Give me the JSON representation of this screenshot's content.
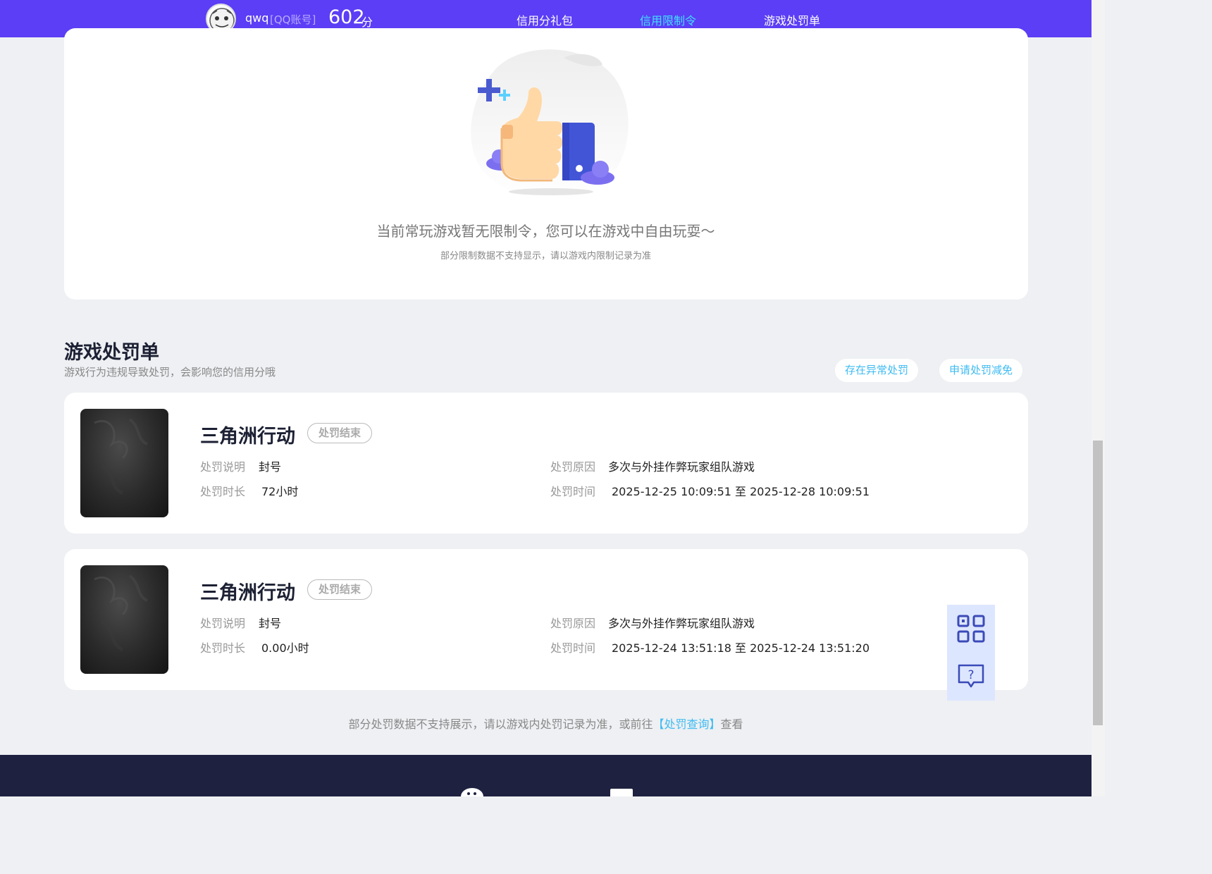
{
  "header": {
    "username": "qwq",
    "account_type": "[QQ账号]",
    "score": "602",
    "score_unit": "分",
    "tabs": [
      "信用分礼包",
      "信用限制令",
      "游戏处罚单"
    ],
    "active_tab": "信用限制令"
  },
  "restriction": {
    "message": "当前常玩游戏暂无限制令，您可以在游戏中自由玩耍～",
    "sub_message": "部分限制数据不支持显示，请以游戏内限制记录为准"
  },
  "penalty_section": {
    "title": "游戏处罚单",
    "description": "游戏行为违规导致处罚，会影响您的信用分哦",
    "buttons": [
      "存在异常处罚",
      "申请处罚减免"
    ]
  },
  "penalty_labels": {
    "desc": "处罚说明",
    "duration": "处罚时长",
    "reason": "处罚原因",
    "time": "处罚时间"
  },
  "penalties": [
    {
      "game": "三角洲行动",
      "status": "处罚结束",
      "desc": "封号",
      "duration": "72小时",
      "reason": "多次与外挂作弊玩家组队游戏",
      "time": "2025-12-25 10:09:51 至 2025-12-28 10:09:51"
    },
    {
      "game": "三角洲行动",
      "status": "处罚结束",
      "desc": "封号",
      "duration": "0.00小时",
      "reason": "多次与外挂作弊玩家组队游戏",
      "time": "2025-12-24 13:51:18 至 2025-12-24 13:51:20"
    }
  ],
  "bottom_note": {
    "prefix": "部分处罚数据不支持展示，请以游戏内处罚记录为准，或前往",
    "link": "【处罚查询】",
    "suffix": "查看"
  },
  "colors": {
    "nav_bg": "#5b3ef5",
    "accent_cyan": "#41e0ff",
    "link_blue": "#3ebbf2",
    "footer_bg": "#1e213f"
  },
  "icons": [
    "qrcode-icon",
    "help-chat-icon",
    "thumbs-up-illustration"
  ]
}
